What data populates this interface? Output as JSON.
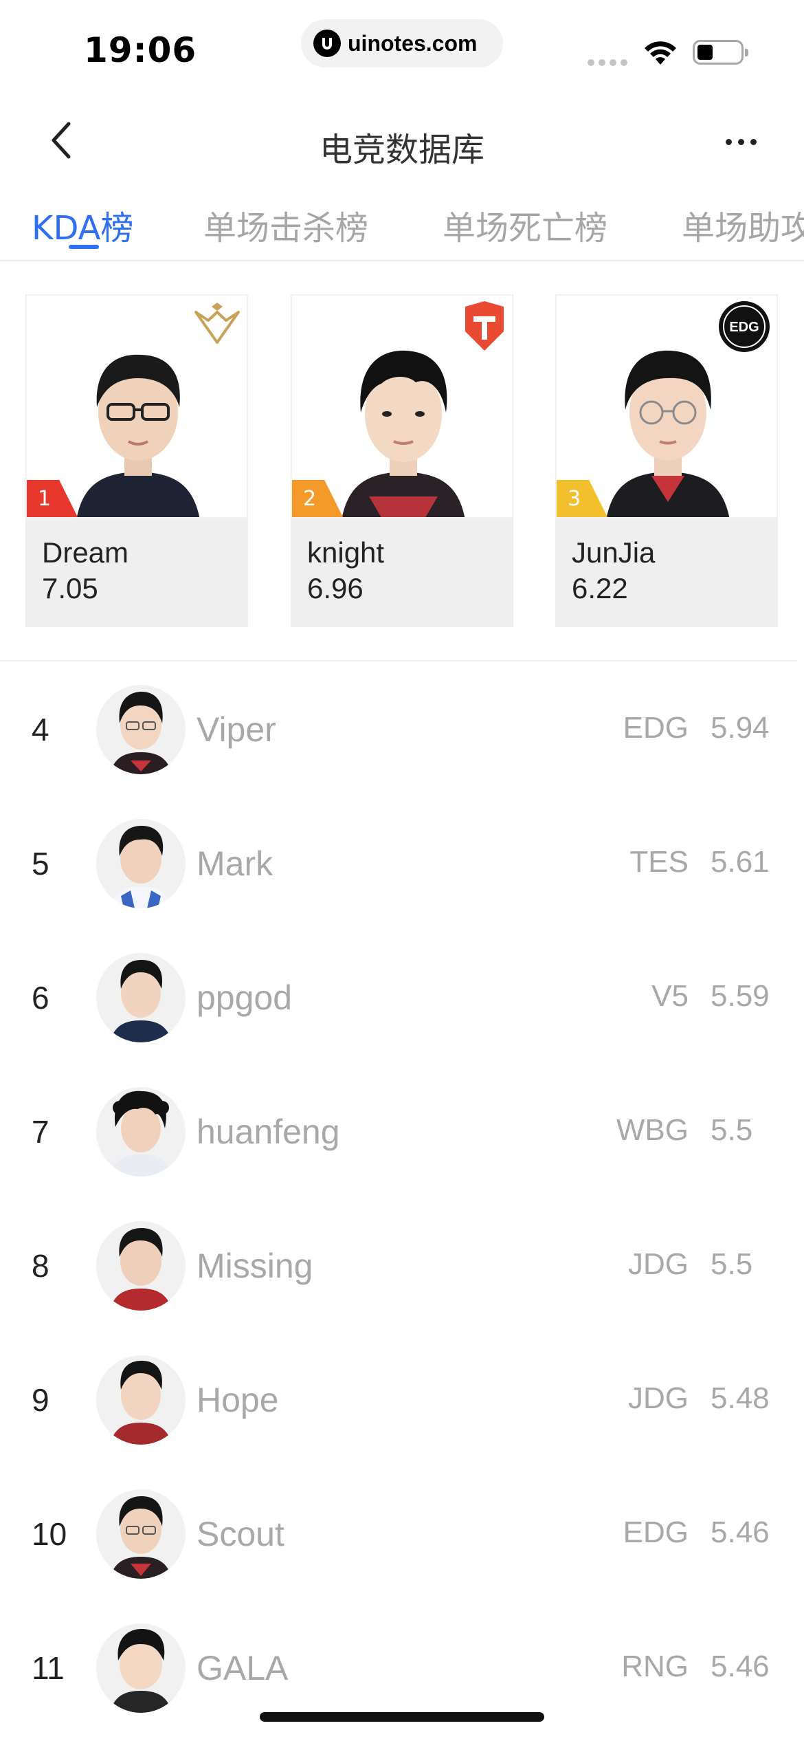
{
  "status_bar": {
    "time": "19:06",
    "url": "uinotes.com"
  },
  "nav": {
    "title": "电竞数据库"
  },
  "tabs": [
    {
      "label": "KDA榜",
      "active": true
    },
    {
      "label": "单场击杀榜",
      "active": false
    },
    {
      "label": "单场死亡榜",
      "active": false
    },
    {
      "label": "单场助攻",
      "active": false
    }
  ],
  "top_players": [
    {
      "rank": "1",
      "name": "Dream",
      "score": "7.05",
      "team_badge": "golden-wings-logo",
      "flag_color": "#e8372c"
    },
    {
      "rank": "2",
      "name": "knight",
      "score": "6.96",
      "team_badge": "red-shield-logo",
      "flag_color": "#f39a2b"
    },
    {
      "rank": "3",
      "name": "JunJia",
      "score": "6.22",
      "team_badge": "edg-logo",
      "flag_color": "#f2c02c"
    }
  ],
  "edg_badge_text": "EDG",
  "ranking": [
    {
      "rank": "4",
      "name": "Viper",
      "team": "EDG",
      "score": "5.94"
    },
    {
      "rank": "5",
      "name": "Mark",
      "team": "TES",
      "score": "5.61"
    },
    {
      "rank": "6",
      "name": "ppgod",
      "team": "V5",
      "score": "5.59"
    },
    {
      "rank": "7",
      "name": "huanfeng",
      "team": "WBG",
      "score": "5.5"
    },
    {
      "rank": "8",
      "name": "Missing",
      "team": "JDG",
      "score": "5.5"
    },
    {
      "rank": "9",
      "name": "Hope",
      "team": "JDG",
      "score": "5.48"
    },
    {
      "rank": "10",
      "name": "Scout",
      "team": "EDG",
      "score": "5.46"
    },
    {
      "rank": "11",
      "name": "GALA",
      "team": "RNG",
      "score": "5.46"
    }
  ],
  "colors": {
    "accent": "#2f6ff2",
    "muted_text": "#a8a8a8",
    "card_bg": "#efefef"
  }
}
